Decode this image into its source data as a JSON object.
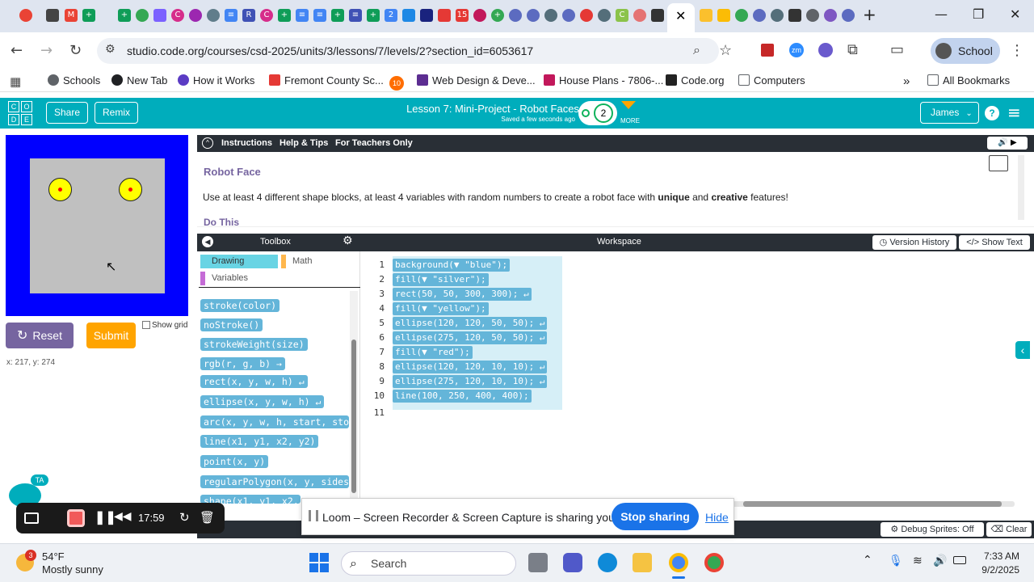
{
  "browser": {
    "url": "studio.code.org/courses/csd-2025/units/3/lessons/7/levels/2?section_id=6053617",
    "profile_label": "School",
    "tab_count_badge": "2"
  },
  "bookmarks": {
    "items": [
      {
        "label": "Schools",
        "color": "#5f6368"
      },
      {
        "label": "New Tab",
        "color": "#202124"
      },
      {
        "label": "How it Works",
        "color": "#5b3cc4"
      },
      {
        "label": "Fremont County Sc...",
        "color": "#e53935"
      },
      {
        "label": "",
        "color": "#ff6d00"
      },
      {
        "label": "Web Design & Deve...",
        "color": "#5c2d91"
      },
      {
        "label": "House Plans - 7806-...",
        "color": "#c2185b"
      },
      {
        "label": "Code.org",
        "color": "#222"
      },
      {
        "label": "Computers",
        "color": "#5f6368"
      }
    ],
    "all_bookmarks": "All Bookmarks",
    "badge_10": "10"
  },
  "header": {
    "share": "Share",
    "remix": "Remix",
    "lesson_title": "Lesson 7: Mini-Project - Robot Faces",
    "saved": "Saved a few seconds ago",
    "progress_level": "2",
    "more": "MORE",
    "user": "James",
    "logo_letters": [
      "C",
      "O",
      "D",
      "E"
    ]
  },
  "stage": {
    "reset": "Reset",
    "submit": "Submit",
    "show_grid": "Show grid",
    "coords": "x: 217,   y: 274"
  },
  "instructions": {
    "tabs": [
      "Instructions",
      "Help & Tips",
      "For Teachers Only"
    ],
    "title": "Robot Face",
    "body_pre": "Use at least 4 different shape blocks, at least 4 variables with random numbers to create a robot face with ",
    "body_b1": "unique",
    "body_mid": " and ",
    "body_b2": "creative",
    "body_post": " features!",
    "do_this": "Do This"
  },
  "toolbox": {
    "title": "Toolbox",
    "categories": [
      "Drawing",
      "Math",
      "Variables"
    ],
    "blocks": [
      "stroke(color)",
      "noStroke()",
      "strokeWeight(size)",
      "rgb(r, g, b) →",
      "rect(x, y, w, h) ↵",
      "ellipse(x, y, w, h) ↵",
      "arc(x, y, w, h, start, sto",
      "line(x1, y1, x2, y2)",
      "point(x, y)",
      "regularPolygon(x, y, sides",
      "shape(x1, y1, x2,"
    ]
  },
  "workspace": {
    "title": "Workspace",
    "version_history": "Version History",
    "show_text": "Show Text",
    "lines": [
      "background(▼ \"blue\");",
      "fill(▼ \"silver\");",
      "rect(50, 50, 300, 300); ↵",
      "fill(▼ \"yellow\");",
      "ellipse(120, 120, 50, 50); ↵",
      "ellipse(275, 120, 50, 50); ↵",
      "fill(▼ \"red\");",
      "ellipse(120, 120, 10, 10); ↵",
      "ellipse(275, 120, 10, 10); ↵",
      "line(100, 250, 400, 400);",
      ""
    ],
    "line_numbers": [
      "1",
      "2",
      "3",
      "4",
      "5",
      "6",
      "7",
      "8",
      "9",
      "10",
      "11"
    ]
  },
  "debug": {
    "sprites": "Debug Sprites: Off",
    "clear": "Clear"
  },
  "loom": {
    "message": "Loom – Screen Recorder & Screen Capture is sharing your screen.",
    "stop": "Stop sharing",
    "hide": "Hide",
    "timer": "17:59",
    "ta": "TA"
  },
  "taskbar": {
    "weather_temp": "54°F",
    "weather_desc": "Mostly sunny",
    "weather_badge": "3",
    "search": "Search",
    "time": "7:33 AM",
    "date": "9/2/2025"
  },
  "colors": {
    "codeorg_teal": "#00adbc",
    "dark_bar": "#292f36",
    "block_blue": "#64b5d9",
    "stage_blue": "#0000ff",
    "reset_purple": "#7665a0",
    "submit_orange": "#ffa400",
    "lesson_purple": "#7665a0"
  }
}
